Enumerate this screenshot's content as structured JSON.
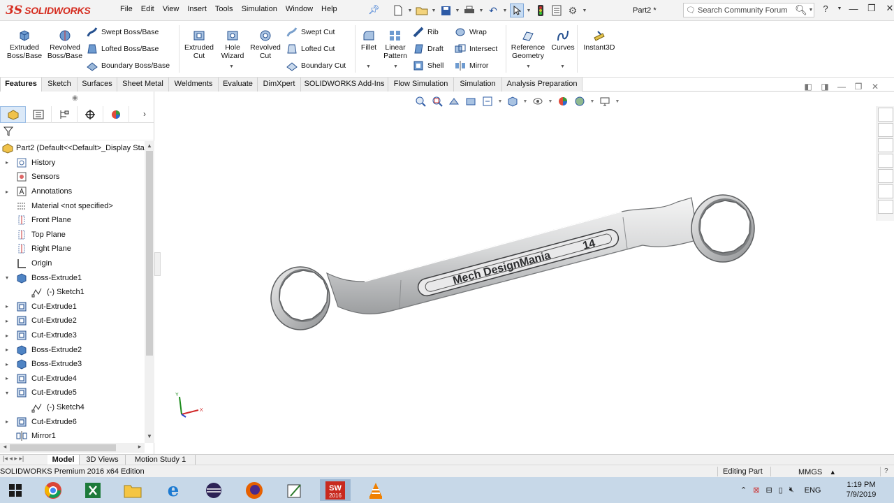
{
  "app": {
    "logo_ds": "3S",
    "logo_text": "SOLIDWORKS",
    "document_title": "Part2 *",
    "menu": [
      "File",
      "Edit",
      "View",
      "Insert",
      "Tools",
      "Simulation",
      "Window",
      "Help"
    ],
    "search_placeholder": "Search Community Forum"
  },
  "ribbon": {
    "extruded_boss": [
      "Extruded",
      "Boss/Base"
    ],
    "revolved_boss": [
      "Revolved",
      "Boss/Base"
    ],
    "swept_boss": "Swept Boss/Base",
    "lofted_boss": "Lofted Boss/Base",
    "boundary_boss": "Boundary Boss/Base",
    "extruded_cut": [
      "Extruded",
      "Cut"
    ],
    "hole_wizard": [
      "Hole",
      "Wizard"
    ],
    "revolved_cut": [
      "Revolved",
      "Cut"
    ],
    "swept_cut": "Swept Cut",
    "lofted_cut": "Lofted Cut",
    "boundary_cut": "Boundary Cut",
    "fillet": "Fillet",
    "linear_pattern": [
      "Linear",
      "Pattern"
    ],
    "rib": "Rib",
    "draft": "Draft",
    "shell": "Shell",
    "wrap": "Wrap",
    "intersect": "Intersect",
    "mirror": "Mirror",
    "reference_geometry": [
      "Reference",
      "Geometry"
    ],
    "curves": "Curves",
    "instant3d": "Instant3D"
  },
  "command_tabs": [
    "Features",
    "Sketch",
    "Surfaces",
    "Sheet Metal",
    "Weldments",
    "Evaluate",
    "DimXpert",
    "SOLIDWORKS Add-Ins",
    "Flow Simulation",
    "Simulation",
    "Analysis Preparation"
  ],
  "tree": {
    "root": "Part2  (Default<<Default>_Display Sta",
    "items": [
      {
        "label": "History",
        "expander": "▸"
      },
      {
        "label": "Sensors",
        "expander": ""
      },
      {
        "label": "Annotations",
        "expander": "▸"
      },
      {
        "label": "Material <not specified>",
        "expander": ""
      },
      {
        "label": "Front Plane",
        "expander": ""
      },
      {
        "label": "Top Plane",
        "expander": ""
      },
      {
        "label": "Right Plane",
        "expander": ""
      },
      {
        "label": "Origin",
        "expander": ""
      },
      {
        "label": "Boss-Extrude1",
        "expander": "▾"
      },
      {
        "label": "(-) Sketch1",
        "expander": "",
        "child": true
      },
      {
        "label": "Cut-Extrude1",
        "expander": "▸"
      },
      {
        "label": "Cut-Extrude2",
        "expander": "▸"
      },
      {
        "label": "Cut-Extrude3",
        "expander": "▸"
      },
      {
        "label": "Boss-Extrude2",
        "expander": "▸"
      },
      {
        "label": "Boss-Extrude3",
        "expander": "▸"
      },
      {
        "label": "Cut-Extrude4",
        "expander": "▸"
      },
      {
        "label": "Cut-Extrude5",
        "expander": "▾"
      },
      {
        "label": "(-) Sketch4",
        "expander": "",
        "child": true
      },
      {
        "label": "Cut-Extrude6",
        "expander": "▸"
      },
      {
        "label": "Mirror1",
        "expander": ""
      }
    ]
  },
  "model": {
    "engraving": "Mech DesignMania",
    "size_label": "14",
    "triad_x": "X",
    "triad_y": "Y"
  },
  "bottom_tabs": [
    "Model",
    "3D Views",
    "Motion Study 1"
  ],
  "status": {
    "edition": "SOLIDWORKS Premium 2016 x64 Edition",
    "editing": "Editing Part",
    "units": "MMGS",
    "units_arrow": "▴"
  },
  "taskbar": {
    "lang": "ENG",
    "time": "1:19 PM",
    "date": "7/9/2019",
    "sw_badge": "2016"
  },
  "colors": {
    "brand_red": "#d52b1e",
    "accent_blue": "#1f4e9b",
    "taskbar": "#c7d8e8",
    "wrench_steel": "#cfd1d3"
  }
}
